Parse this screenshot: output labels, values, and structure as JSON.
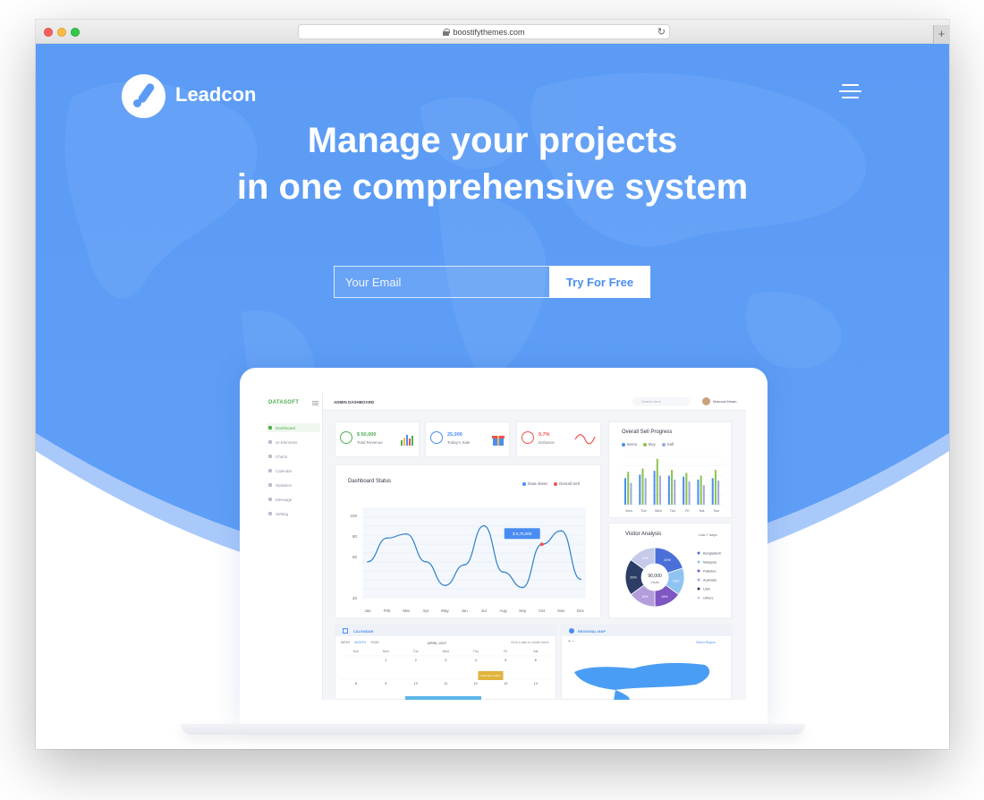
{
  "browser": {
    "url": "boostifythemes.com",
    "new_tab_label": "+"
  },
  "site": {
    "brand": "Leadcon",
    "headline_line1": "Manage your projects",
    "headline_line2": "in one comprehensive system",
    "email_placeholder": "Your Email",
    "cta_label": "Try For Free"
  },
  "colors": {
    "hero_blue": "#5b9bf5",
    "hero_light_band": "#a9c9fb",
    "accent_green": "#4caf50",
    "accent_red": "#ef5350",
    "accent_blue": "#4a8df2"
  },
  "dashboard": {
    "logo": "DATASOFT",
    "title": "ADMIN DASHBOARD",
    "search_placeholder": "Search here",
    "user_name": "Masoud Ahsan",
    "sidebar": [
      {
        "label": "Dashboard",
        "icon": "home-icon",
        "active": true
      },
      {
        "label": "UI Elements",
        "icon": "user-icon",
        "active": false
      },
      {
        "label": "Charts",
        "icon": "chart-icon",
        "active": false
      },
      {
        "label": "Calendar",
        "icon": "calendar-icon",
        "active": false
      },
      {
        "label": "Statistics",
        "icon": "stats-icon",
        "active": false
      },
      {
        "label": "Message",
        "icon": "message-icon",
        "active": false
      },
      {
        "label": "Setting",
        "icon": "gear-icon",
        "active": false
      }
    ],
    "stats": [
      {
        "value": "$ 50,000",
        "label": "Total Revenue",
        "color": "#4caf50"
      },
      {
        "value": "25,000",
        "label": "Today's Sale",
        "color": "#4a8df2"
      },
      {
        "value": "0.7%",
        "label": "Enhance",
        "color": "#ef5350"
      }
    ],
    "dashboard_status": {
      "title": "Dashboard Status",
      "legend": [
        "Data sheet",
        "Overall Sell"
      ],
      "tooltip": "$ 5,75,000"
    },
    "sell_progress": {
      "title": "Overall Sell Progress",
      "legend": [
        "Items",
        "Buy",
        "Sell"
      ]
    },
    "visitor": {
      "title": "Visitor Analysis",
      "period": "Last 7 days",
      "center_value": "90,000",
      "center_label": "Visits",
      "legend": [
        "Bangladesh",
        "Malaysia",
        "Pakistan",
        "Australia",
        "USA",
        "Others"
      ]
    },
    "calendar": {
      "title": "CALENDAR",
      "views": [
        "WEEK",
        "MONTH",
        "YEAR"
      ],
      "month": "APRIL 2017",
      "hint": "Click a date to create event",
      "days": [
        "Sun",
        "Mon",
        "Tue",
        "Wed",
        "Thu",
        "Fri",
        "Sat"
      ],
      "row1": [
        "",
        "1",
        "2",
        "3",
        "4",
        "5",
        "6"
      ],
      "row2": [
        "8",
        "9",
        "10",
        "11",
        "12",
        "13",
        "14"
      ],
      "event": "Meeting at office"
    },
    "map": {
      "title": "REGIONAL MAP",
      "select": "Select Region"
    }
  },
  "chart_data": [
    {
      "type": "line",
      "title": "Dashboard Status",
      "categories": [
        "Jan",
        "Feb",
        "Mar",
        "Apr",
        "May",
        "Jun",
        "Jul",
        "Aug",
        "Sep",
        "Oct",
        "Nov",
        "Dec"
      ],
      "ylim": [
        20,
        100
      ],
      "yticks": [
        100,
        80,
        60,
        20
      ],
      "series": [
        {
          "name": "Data sheet",
          "values": [
            55,
            78,
            82,
            55,
            32,
            52,
            90,
            45,
            30,
            72,
            85,
            38
          ]
        }
      ]
    },
    {
      "type": "bar",
      "title": "Overall Sell Progress",
      "categories": [
        "Mon",
        "Tue",
        "Wed",
        "Thu",
        "Fri",
        "Sat",
        "Sun"
      ],
      "ylim": [
        0,
        100
      ],
      "series": [
        {
          "name": "Items",
          "values": [
            55,
            62,
            70,
            60,
            58,
            52,
            55
          ]
        },
        {
          "name": "Buy",
          "values": [
            68,
            75,
            95,
            72,
            66,
            60,
            72
          ]
        },
        {
          "name": "Sell",
          "values": [
            45,
            55,
            60,
            52,
            48,
            40,
            50
          ]
        }
      ]
    },
    {
      "type": "pie",
      "title": "Visitor Analysis",
      "categories": [
        "Bangladesh",
        "Malaysia",
        "Pakistan",
        "Australia",
        "USA",
        "Others"
      ],
      "values": [
        20,
        15,
        15,
        15,
        20,
        15
      ],
      "labels": [
        "20%",
        "15%",
        "15%",
        "15%",
        "20%",
        "15%"
      ]
    }
  ]
}
